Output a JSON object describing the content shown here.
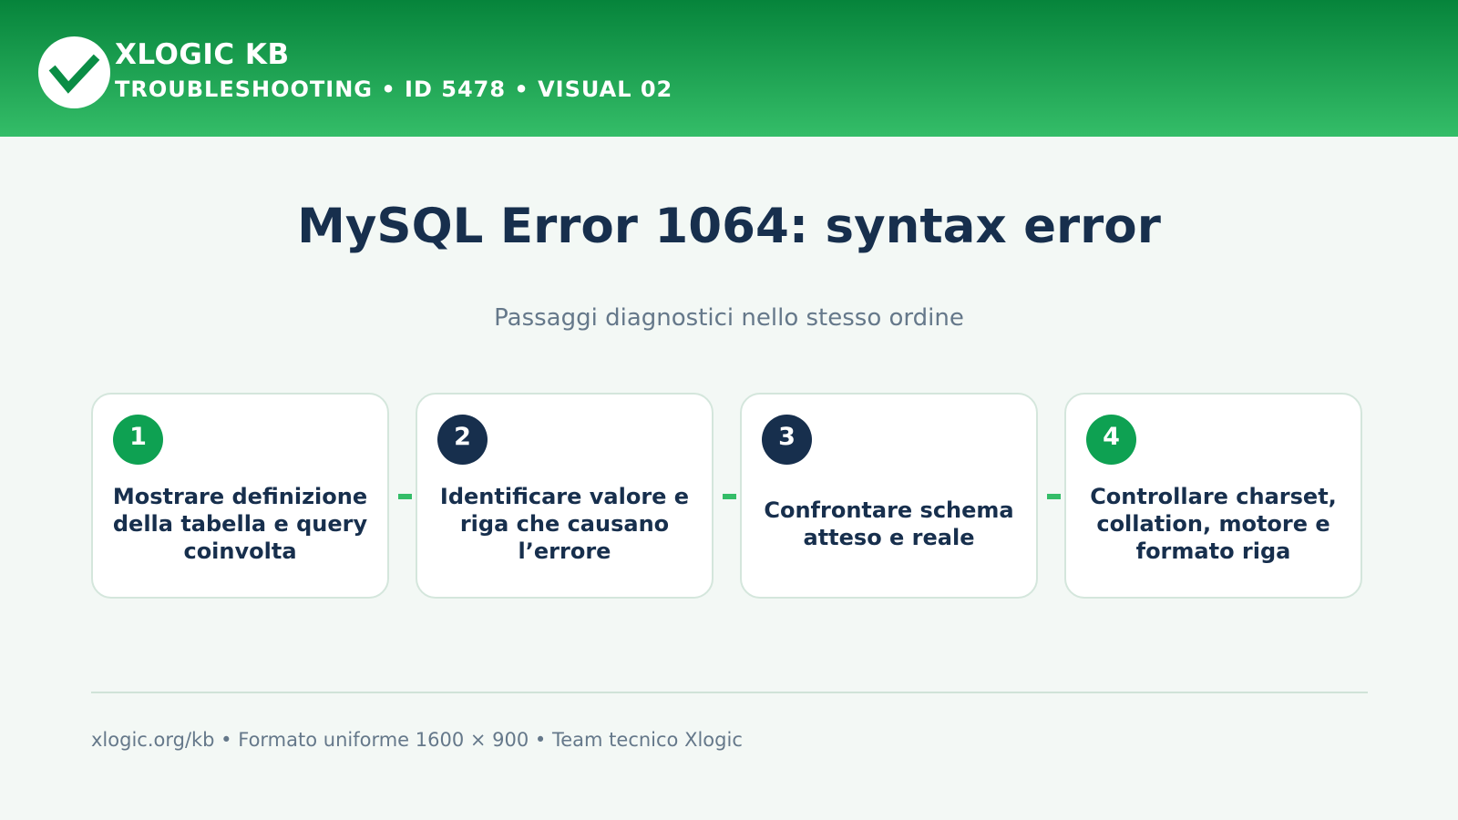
{
  "header": {
    "brand_title": "XLOGIC KB",
    "brand_subtitle": "TROUBLESHOOTING • ID 5478 • VISUAL 02",
    "logo_icon": "checkmark-icon"
  },
  "title": "MySQL Error 1064: syntax error",
  "subtitle": "Passaggi diagnostici nello stesso ordine",
  "steps": [
    {
      "number": "1",
      "text": "Mostrare definizione della tabella e query coinvolta",
      "badge_color": "#0ea152"
    },
    {
      "number": "2",
      "text": "Identificare valore e riga che causano l’errore",
      "badge_color": "#172f4d"
    },
    {
      "number": "3",
      "text": "Confrontare schema atteso e reale",
      "badge_color": "#172f4d"
    },
    {
      "number": "4",
      "text": "Controllare charset, collation, motore e formato riga",
      "badge_color": "#0ea152"
    }
  ],
  "footer": "xlogic.org/kb • Formato uniforme 1600 × 900 • Team tecnico Xlogic",
  "colors": {
    "brand_green": "#06843b",
    "accent_green": "#34bd68",
    "navy": "#172f4d",
    "muted_text": "#65788a",
    "background": "#f3f8f5"
  }
}
